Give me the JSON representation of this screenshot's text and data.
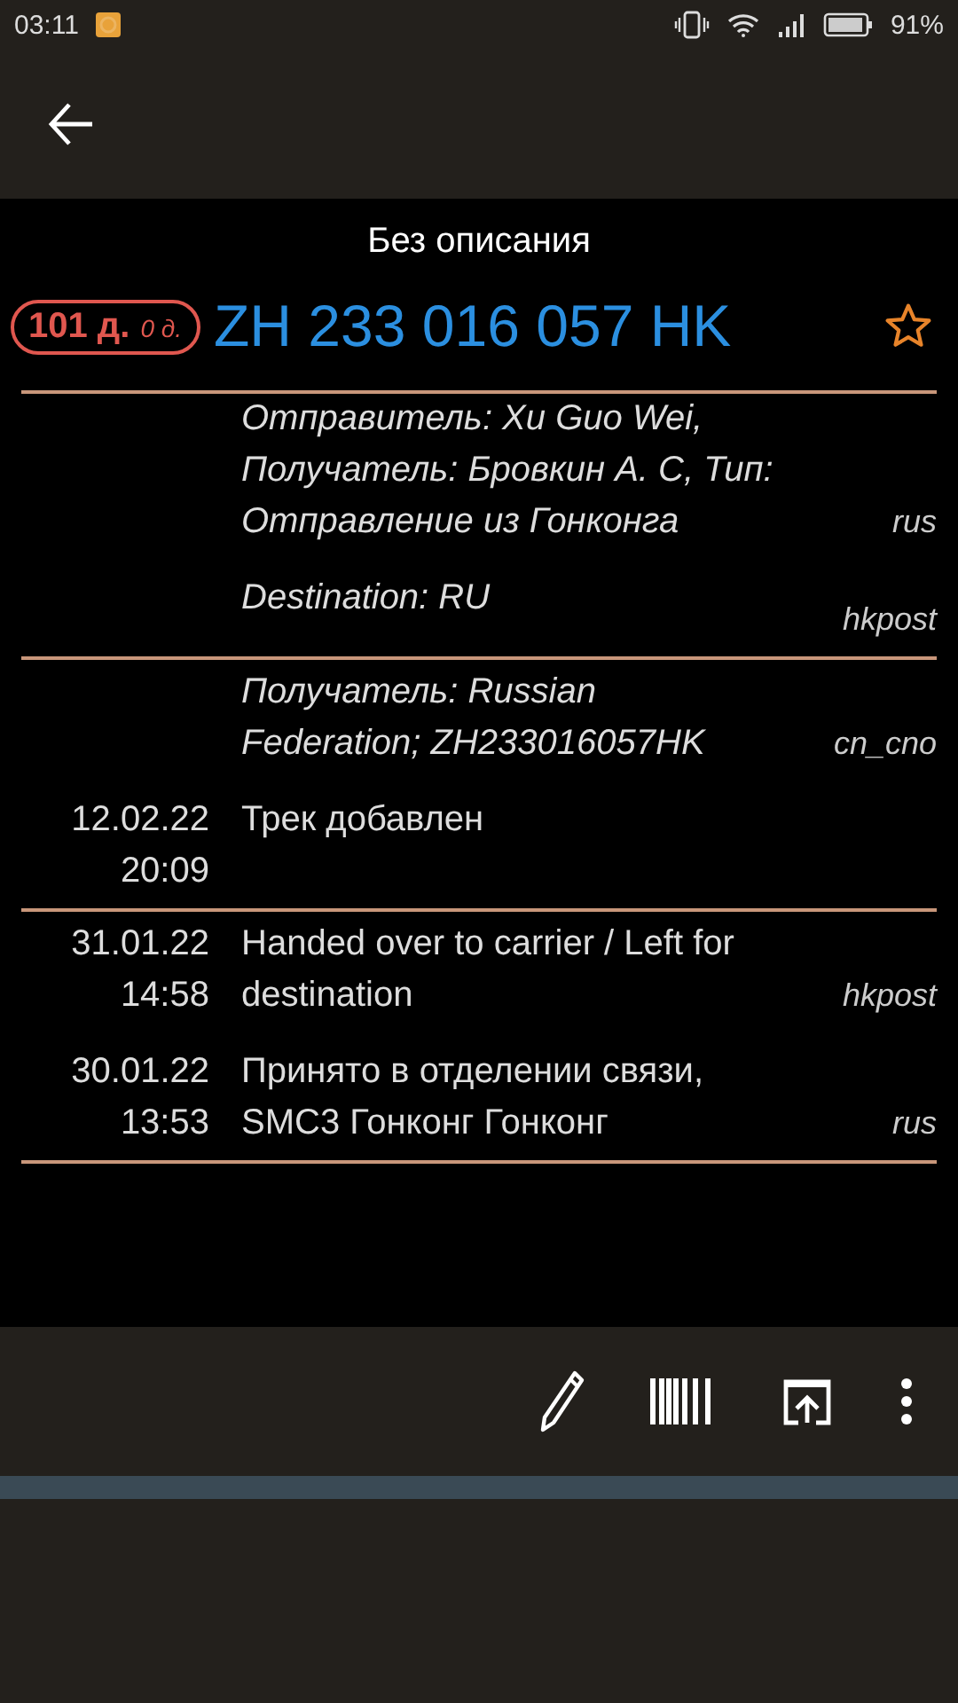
{
  "status_bar": {
    "time": "03:11",
    "battery": "91%"
  },
  "title": "Без описания",
  "badge": {
    "days": "101 д.",
    "days_since": "0 д."
  },
  "tracking_number": "ZH 233 016 057 HK",
  "favorite": false,
  "groups": [
    [
      {
        "kind": "info",
        "text": "Отправитель: Xu Guo Wei, Получатель: Бровкин А. С, Тип: Отправление из Гонконга",
        "source": "rus"
      },
      {
        "kind": "info",
        "text": "Destination: RU",
        "source": "hkpost"
      }
    ],
    [
      {
        "kind": "info",
        "text": "Получатель: Russian Federation; ZH233016057HK",
        "source": "cn_cno"
      },
      {
        "kind": "event",
        "date": "12.02.22",
        "time": "20:09",
        "text": "Трек добавлен"
      }
    ],
    [
      {
        "kind": "event",
        "date": "31.01.22",
        "time": "14:58",
        "text": "Handed over to carrier / Left for destination",
        "source": "hkpost"
      },
      {
        "kind": "event",
        "date": "30.01.22",
        "time": "13:53",
        "text": "Принято в отделении связи, SMC3 Гонконг Гонконг",
        "source": "rus"
      }
    ]
  ]
}
